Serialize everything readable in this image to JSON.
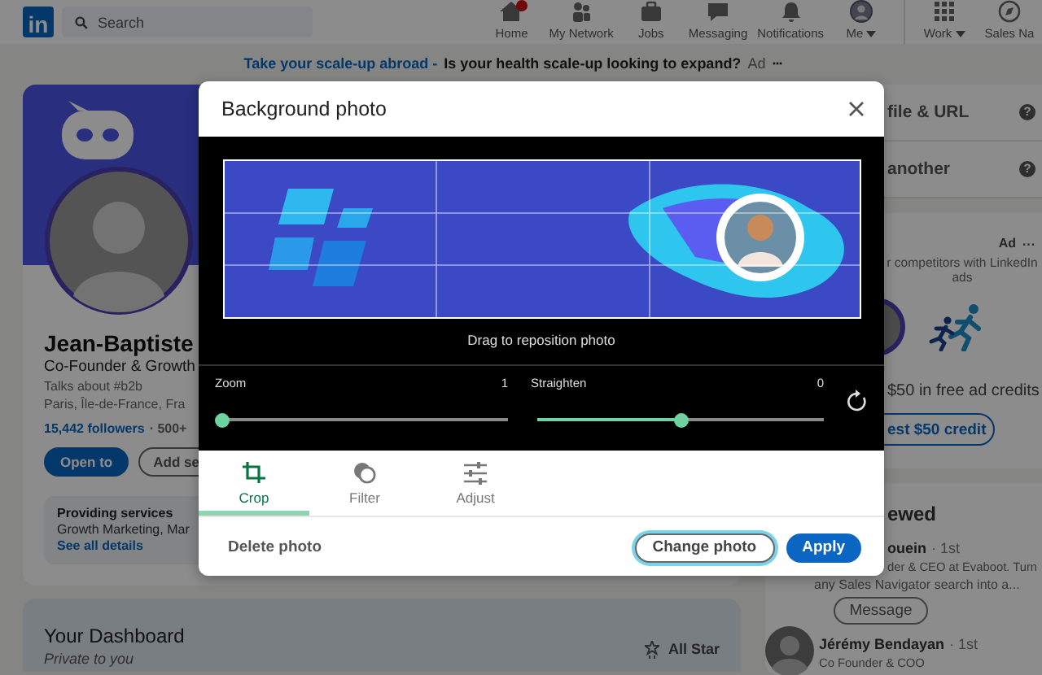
{
  "nav": {
    "logo": "in",
    "search": {
      "placeholder": "Search"
    },
    "items": [
      {
        "label": "Home",
        "badge": true,
        "dropdown": false
      },
      {
        "label": "My Network",
        "badge": false,
        "dropdown": false
      },
      {
        "label": "Jobs",
        "badge": false,
        "dropdown": false
      },
      {
        "label": "Messaging",
        "badge": false,
        "dropdown": false
      },
      {
        "label": "Notifications",
        "badge": false,
        "dropdown": false
      },
      {
        "label": "Me",
        "badge": false,
        "dropdown": true
      }
    ],
    "business_items": [
      {
        "label": "Work",
        "dropdown": true
      },
      {
        "label": "Sales Na",
        "dropdown": false
      }
    ]
  },
  "ad_banner": {
    "link": "Take your scale-up abroad -",
    "text": "Is your health scale-up looking to expand?",
    "label": "Ad",
    "more": "···"
  },
  "profile": {
    "name": "Jean-Baptiste",
    "headline": "Co-Founder & Growth",
    "talks": "Talks about #b2b",
    "location": "Paris, Île-de-France, Fra",
    "followers": "15,442 followers",
    "connections": "· 500+",
    "buttons": [
      {
        "label": "Open to",
        "kind": "primary"
      },
      {
        "label": "Add se",
        "kind": "outline"
      }
    ],
    "services": {
      "title": "Providing services",
      "text": "Growth Marketing, Mar",
      "link": "See all details"
    }
  },
  "dashboard": {
    "title": "Your Dashboard",
    "subtitle": "Private to you",
    "badge": "All Star"
  },
  "right_rail": {
    "links": [
      {
        "label": "file & URL",
        "help": "?"
      },
      {
        "label": "another",
        "help": "?"
      }
    ],
    "promo": {
      "label": "Ad",
      "more": "···",
      "text": "r competitors with LinkedIn ads",
      "offer": "$50 in free ad credits",
      "cta": "est $50 credit"
    },
    "viewed": {
      "title": "ewed",
      "people": [
        {
          "name": "ouein",
          "degree": "· 1st",
          "headline": "der & CEO at Evaboot. Turn",
          "summary": "any Sales Navigator search into a...",
          "button": "Message"
        },
        {
          "name": "Jérémy Bendayan",
          "degree": "· 1st",
          "headline": "Co Founder & COO"
        }
      ]
    }
  },
  "modal": {
    "title": "Background photo",
    "hint": "Drag to reposition photo",
    "sliders": [
      {
        "label": "Zoom",
        "reading": "1",
        "level": 0
      },
      {
        "label": "Straighten",
        "reading": "0",
        "level": 0.5
      }
    ],
    "tabs": [
      {
        "label": "Crop",
        "selected": true
      },
      {
        "label": "Filter",
        "selected": false
      },
      {
        "label": "Adjust",
        "selected": false
      }
    ],
    "delete": "Delete photo",
    "buttons": [
      {
        "label": "Change photo",
        "kind": "secondary",
        "focused": true
      },
      {
        "label": "Apply",
        "kind": "primary",
        "focused": false
      }
    ]
  }
}
